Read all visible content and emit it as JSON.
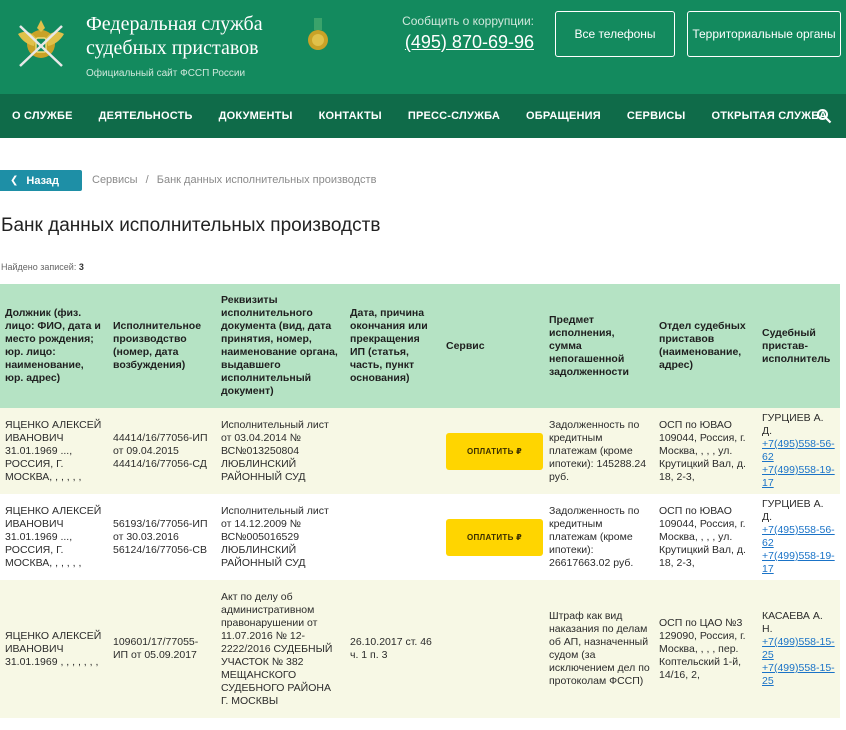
{
  "header": {
    "title_line1": "Федеральная служба",
    "title_line2": "судебных приставов",
    "subtitle": "Официальный сайт ФССП России",
    "hotline_label": "Сообщить о коррупции:",
    "hotline_phone": "(495) 870-69-96",
    "btn_phones": "Все телефоны",
    "btn_regions": "Территориальные органы",
    "colors": {
      "header_bg": "#138a5e",
      "nav_bg": "#0f6b49"
    }
  },
  "nav": {
    "items": [
      {
        "label": "О СЛУЖБЕ"
      },
      {
        "label": "ДЕЯТЕЛЬНОСТЬ"
      },
      {
        "label": "ДОКУМЕНТЫ"
      },
      {
        "label": "КОНТАКТЫ"
      },
      {
        "label": "ПРЕСС-СЛУЖБА"
      },
      {
        "label": "ОБРАЩЕНИЯ"
      },
      {
        "label": "СЕРВИСЫ"
      },
      {
        "label": "ОТКРЫТАЯ СЛУЖБА"
      }
    ],
    "search_icon": "search-icon"
  },
  "back_label": "Назад",
  "breadcrumb": {
    "item1": "Сервисы",
    "sep": "/",
    "item2": "Банк данных исполнительных производств"
  },
  "page_title": "Банк данных исполнительных производств",
  "records": {
    "label": "Найдено записей:",
    "value": "3"
  },
  "table": {
    "headers": {
      "debtor": "Должник (физ. лицо: ФИО, дата и место рождения; юр. лицо: наименование, юр. адрес)",
      "proceeding": "Исполнительное производство (номер, дата возбуждения)",
      "document": "Реквизиты исполнительного документа (вид, дата принятия, номер, наименование органа, выдавшего исполнительный документ)",
      "end": "Дата, причина окончания или прекращения ИП (статья, часть, пункт основания)",
      "service": "Сервис",
      "subject": "Предмет исполнения, сумма непогашенной задолженности",
      "department": "Отдел судебных приставов (наименование, адрес)",
      "bailiff": "Судебный пристав-исполнитель"
    },
    "pay_label": "ОПЛАТИТЬ ₽",
    "rows": [
      {
        "debtor": "ЯЦЕНКО АЛЕКСЕЙ ИВАНОВИЧ 31.01.1969 ..., РОССИЯ, Г. МОСКВА, , , , , ,",
        "proceeding": "44414/16/77056-ИП от 09.04.2015 44414/16/77056-СД",
        "document": "Исполнительный лист от 03.04.2014 № ВС№013250804 ЛЮБЛИНСКИЙ РАЙОННЫЙ СУД",
        "end": "",
        "subject": "Задолженность по кредитным платежам (кроме ипотеки): 145288.24 руб.",
        "department": "ОСП по ЮВАО 109044, Россия, г. Москва, , , , ул. Крутицкий Вал, д. 18, 2-3,",
        "bailiff_name": "ГУРЦИЕВ А. Д.",
        "phone1": "+7(495)558-56-62",
        "phone2": "+7(499)558-19-17"
      },
      {
        "debtor": "ЯЦЕНКО АЛЕКСЕЙ ИВАНОВИЧ 31.01.1969 ..., РОССИЯ, Г. МОСКВА, , , , , ,",
        "proceeding": "56193/16/77056-ИП от 30.03.2016 56124/16/77056-СВ",
        "document": "Исполнительный лист от 14.12.2009 № ВС№005016529 ЛЮБЛИНСКИЙ РАЙОННЫЙ СУД",
        "end": "",
        "subject": "Задолженность по кредитным платежам (кроме ипотеки): 26617663.02 руб.",
        "department": "ОСП по ЮВАО 109044, Россия, г. Москва, , , , ул. Крутицкий Вал, д. 18, 2-3,",
        "bailiff_name": "ГУРЦИЕВ А. Д.",
        "phone1": "+7(495)558-56-62",
        "phone2": "+7(499)558-19-17"
      },
      {
        "debtor": "ЯЦЕНКО АЛЕКСЕЙ ИВАНОВИЧ 31.01.1969 , , , , , , ,",
        "proceeding": "109601/17/77055-ИП от 05.09.2017",
        "document": "Акт по делу об административном правонарушении от 11.07.2016 № 12-2222/2016 СУДЕБНЫЙ УЧАСТОК № 382 МЕЩАНСКОГО СУДЕБНОГО РАЙОНА Г. МОСКВЫ",
        "end": "26.10.2017 ст. 46 ч. 1 п. 3",
        "subject": "Штраф как вид наказания по делам об АП, назначенный судом (за исключением дел по протоколам ФССП)",
        "department": "ОСП по ЦАО №3 129090, Россия, г. Москва, , , , пер. Коптельский 1-й, 14/16, 2,",
        "bailiff_name": "КАСАЕВА А. Н.",
        "phone1": "+7(499)558-15-25",
        "phone2": "+7(499)558-15-25"
      }
    ]
  }
}
